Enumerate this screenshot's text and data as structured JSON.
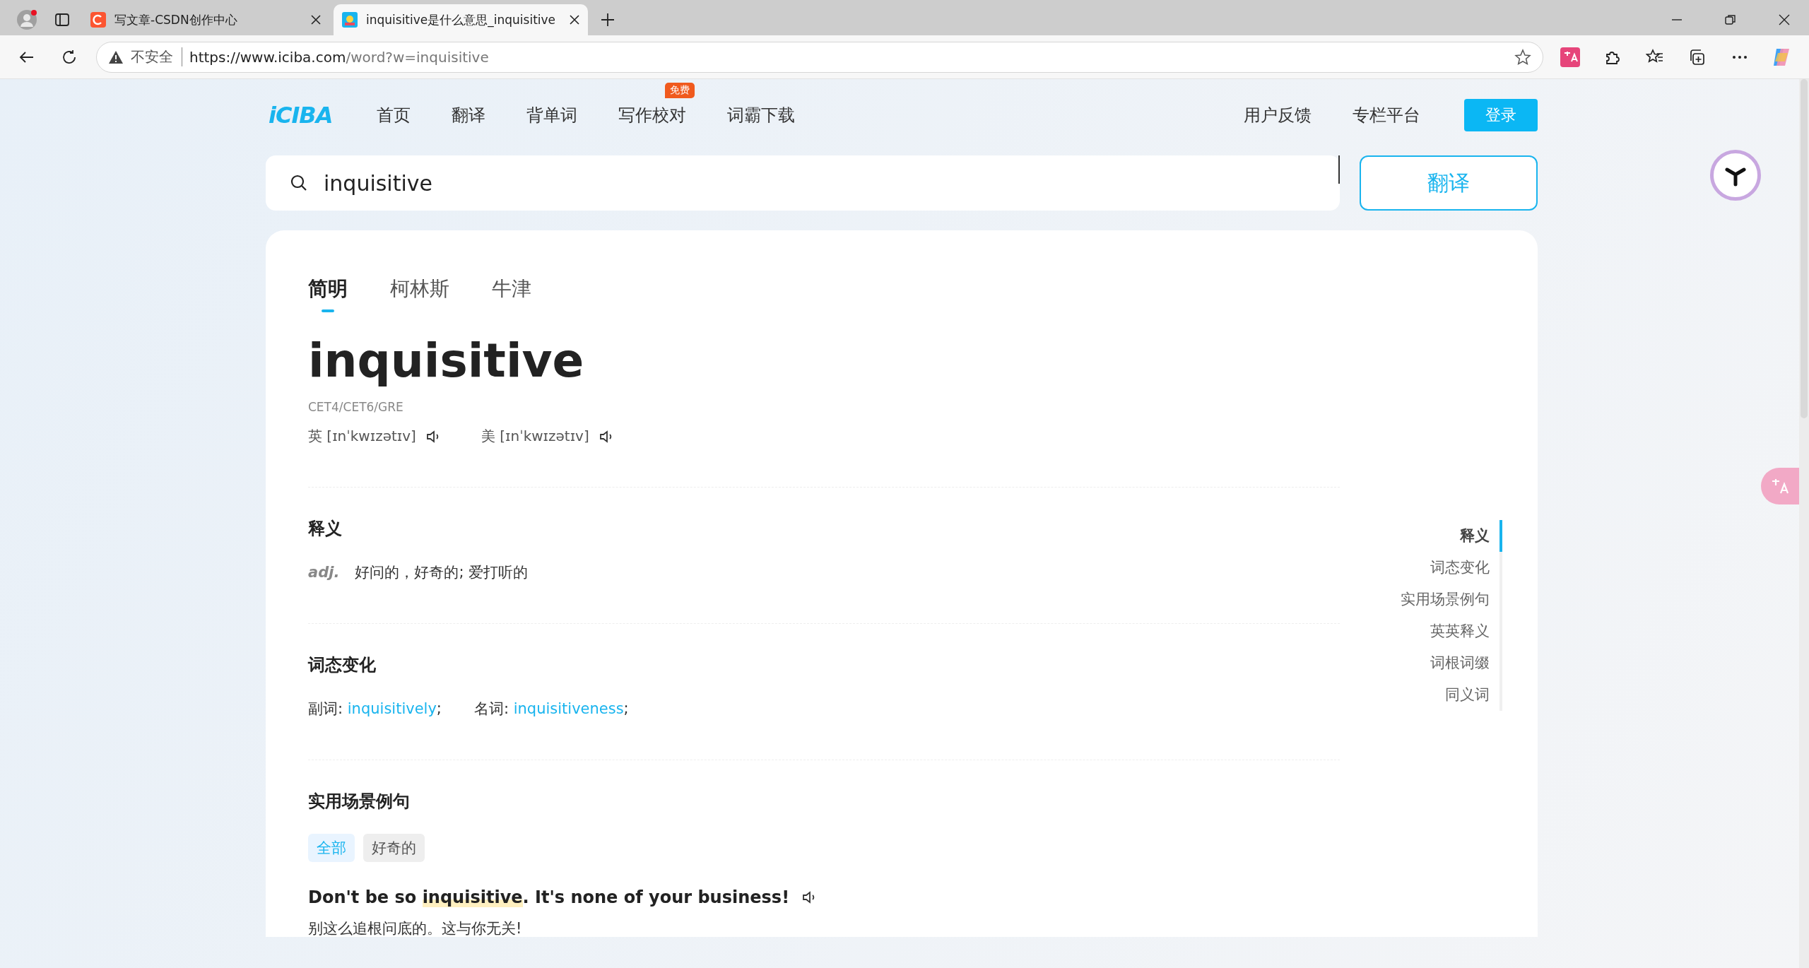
{
  "browser": {
    "tabs": [
      {
        "title": "写文章-CSDN创作中心",
        "kind": "csdn",
        "selected": false
      },
      {
        "title": "inquisitive是什么意思_inquisitive",
        "kind": "iciba",
        "selected": true
      }
    ],
    "security_label": "不安全",
    "url_host": "https://www.iciba.com",
    "url_path": "/word?w=inquisitive"
  },
  "site": {
    "logo": "iCIBA",
    "nav": [
      {
        "label": "首页"
      },
      {
        "label": "翻译"
      },
      {
        "label": "背单词"
      },
      {
        "label": "写作校对",
        "badge": "免费"
      },
      {
        "label": "词霸下载"
      }
    ],
    "nav_right": [
      "用户反馈",
      "专栏平台"
    ],
    "login": "登录"
  },
  "search": {
    "value": "inquisitive",
    "button": "翻译"
  },
  "dict_tabs": [
    {
      "label": "简明",
      "selected": true
    },
    {
      "label": "柯林斯",
      "selected": false
    },
    {
      "label": "牛津",
      "selected": false
    }
  ],
  "word": "inquisitive",
  "levels": "CET4/CET6/GRE",
  "pronunciations": [
    {
      "region": "英",
      "ipa": "[ɪnˈkwɪzətɪv]"
    },
    {
      "region": "美",
      "ipa": "[ɪnˈkwɪzətɪv]"
    }
  ],
  "definitions": {
    "title": "释义",
    "items": [
      {
        "pos": "adj.",
        "meaning": "好问的，好奇的; 爱打听的"
      }
    ]
  },
  "inflections": {
    "title": "词态变化",
    "items": [
      {
        "label": "副词:",
        "word": "inquisitively",
        "sep": ";"
      },
      {
        "label": "名词:",
        "word": "inquisitiveness",
        "sep": ";"
      }
    ]
  },
  "examples": {
    "title": "实用场景例句",
    "filters": [
      {
        "label": "全部",
        "selected": true
      },
      {
        "label": "好奇的",
        "selected": false
      }
    ],
    "items": [
      {
        "before": "Don't be so ",
        "highlight": "inquisitive",
        "after": ". It's none of your business!",
        "translation": "别这么追根问底的。这与你无关!"
      }
    ]
  },
  "side_nav": [
    {
      "label": "释义",
      "selected": true
    },
    {
      "label": "词态变化",
      "selected": false
    },
    {
      "label": "实用场景例句",
      "selected": false
    },
    {
      "label": "英英释义",
      "selected": false
    },
    {
      "label": "词根词缀",
      "selected": false
    },
    {
      "label": "同义词",
      "selected": false
    }
  ]
}
